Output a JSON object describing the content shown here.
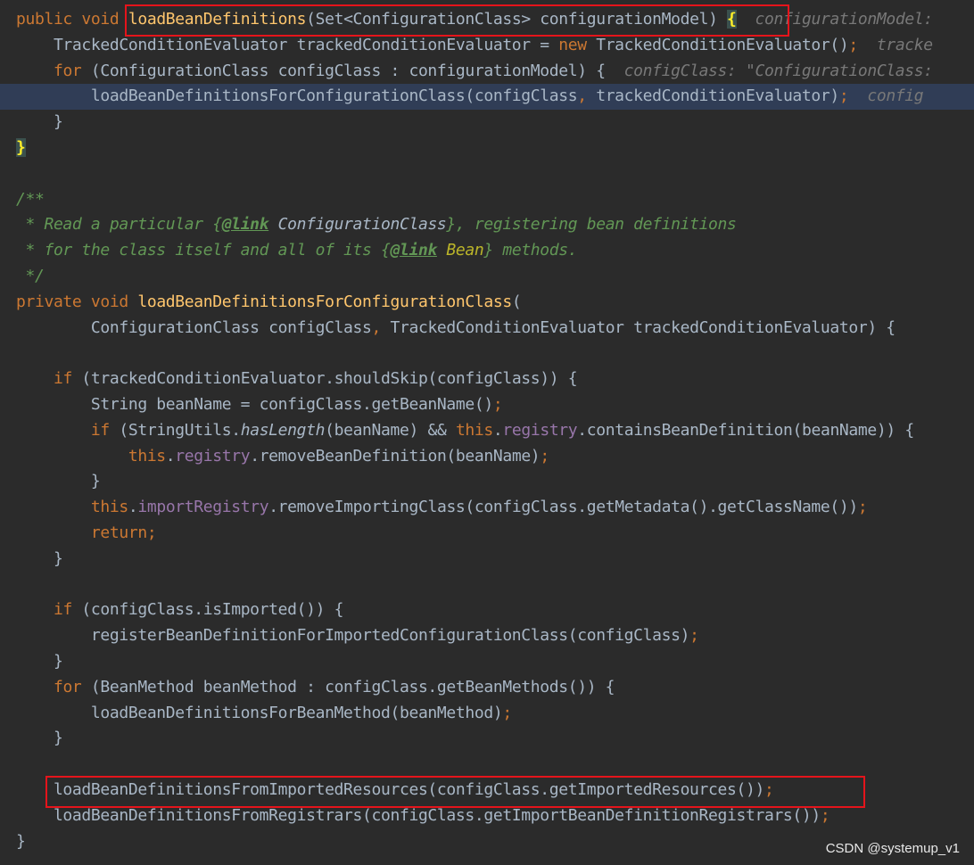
{
  "editor": {
    "lines": [
      [
        [
          "kw",
          "public "
        ],
        [
          "kw",
          "void "
        ],
        [
          "fn",
          "loadBeanDefinitions"
        ],
        [
          "t",
          "(Set<ConfigurationClass> configurationModel) "
        ],
        [
          "brace",
          "{"
        ],
        [
          "t",
          "  "
        ],
        [
          "hint",
          "configurationModel: "
        ]
      ],
      [
        [
          "t",
          "    TrackedConditionEvaluator trackedConditionEvaluator = "
        ],
        [
          "kw",
          "new "
        ],
        [
          "t",
          "TrackedConditionEvaluator()"
        ],
        [
          "kw",
          ";"
        ],
        [
          "t",
          "  "
        ],
        [
          "hint",
          "tracke"
        ]
      ],
      [
        [
          "t",
          "    "
        ],
        [
          "kw",
          "for "
        ],
        [
          "t",
          "(ConfigurationClass configClass : configurationModel) {  "
        ],
        [
          "hint",
          "configClass: \"ConfigurationClass:"
        ]
      ],
      [
        [
          "t",
          "        loadBeanDefinitionsForConfigurationClass(configClass"
        ],
        [
          "kw",
          ", "
        ],
        [
          "t",
          "trackedConditionEvaluator)"
        ],
        [
          "kw",
          ";"
        ],
        [
          "t",
          "  "
        ],
        [
          "hint",
          "config"
        ]
      ],
      [
        [
          "t",
          "    }"
        ]
      ],
      [
        [
          "brace",
          "}"
        ]
      ],
      [],
      [
        [
          "doc",
          "/**"
        ]
      ],
      [
        [
          "doc",
          " * Read a particular {"
        ],
        [
          "doctag",
          "@link"
        ],
        [
          "doc",
          " "
        ],
        [
          "docref",
          "ConfigurationClass"
        ],
        [
          "doc",
          "}, registering bean definitions"
        ]
      ],
      [
        [
          "doc",
          " * for the class itself and all of its {"
        ],
        [
          "doctag",
          "@link"
        ],
        [
          "doc",
          " "
        ],
        [
          "docbean",
          "Bean"
        ],
        [
          "doc",
          "} methods."
        ]
      ],
      [
        [
          "doc",
          " */"
        ]
      ],
      [
        [
          "kw",
          "private "
        ],
        [
          "kw",
          "void "
        ],
        [
          "fn",
          "loadBeanDefinitionsForConfigurationClass"
        ],
        [
          "t",
          "("
        ]
      ],
      [
        [
          "t",
          "        ConfigurationClass configClass"
        ],
        [
          "kw",
          ", "
        ],
        [
          "t",
          "TrackedConditionEvaluator trackedConditionEvaluator) {"
        ]
      ],
      [],
      [
        [
          "t",
          "    "
        ],
        [
          "kw",
          "if "
        ],
        [
          "t",
          "(trackedConditionEvaluator.shouldSkip(configClass)) {"
        ]
      ],
      [
        [
          "t",
          "        String beanName = configClass.getBeanName()"
        ],
        [
          "kw",
          ";"
        ]
      ],
      [
        [
          "t",
          "        "
        ],
        [
          "kw",
          "if "
        ],
        [
          "t",
          "(StringUtils."
        ],
        [
          "it",
          "hasLength"
        ],
        [
          "t",
          "(beanName) && "
        ],
        [
          "kw",
          "this"
        ],
        [
          "t",
          "."
        ],
        [
          "fld",
          "registry"
        ],
        [
          "t",
          ".containsBeanDefinition(beanName)) {"
        ]
      ],
      [
        [
          "t",
          "            "
        ],
        [
          "kw",
          "this"
        ],
        [
          "t",
          "."
        ],
        [
          "fld",
          "registry"
        ],
        [
          "t",
          ".removeBeanDefinition(beanName)"
        ],
        [
          "kw",
          ";"
        ]
      ],
      [
        [
          "t",
          "        }"
        ]
      ],
      [
        [
          "t",
          "        "
        ],
        [
          "kw",
          "this"
        ],
        [
          "t",
          "."
        ],
        [
          "fld",
          "importRegistry"
        ],
        [
          "t",
          ".removeImportingClass(configClass.getMetadata().getClassName())"
        ],
        [
          "kw",
          ";"
        ]
      ],
      [
        [
          "t",
          "        "
        ],
        [
          "kw",
          "return;"
        ]
      ],
      [
        [
          "t",
          "    }"
        ]
      ],
      [],
      [
        [
          "t",
          "    "
        ],
        [
          "kw",
          "if "
        ],
        [
          "t",
          "(configClass.isImported()) {"
        ]
      ],
      [
        [
          "t",
          "        registerBeanDefinitionForImportedConfigurationClass(configClass)"
        ],
        [
          "kw",
          ";"
        ]
      ],
      [
        [
          "t",
          "    }"
        ]
      ],
      [
        [
          "t",
          "    "
        ],
        [
          "kw",
          "for "
        ],
        [
          "t",
          "(BeanMethod beanMethod : configClass.getBeanMethods()) {"
        ]
      ],
      [
        [
          "t",
          "        loadBeanDefinitionsForBeanMethod(beanMethod)"
        ],
        [
          "kw",
          ";"
        ]
      ],
      [
        [
          "t",
          "    }"
        ]
      ],
      [],
      [
        [
          "t",
          "    loadBeanDefinitionsFromImportedResources(configClass.getImportedResources())"
        ],
        [
          "kw",
          ";"
        ]
      ],
      [
        [
          "t",
          "    loadBeanDefinitionsFromRegistrars(configClass.getImportBeanDefinitionRegistrars())"
        ],
        [
          "kw",
          ";"
        ]
      ],
      [
        [
          "t",
          "}"
        ]
      ]
    ]
  },
  "watermark": "CSDN @systemup_v1",
  "colors": {
    "background": "#2b2b2b",
    "current_line": "#303d56",
    "keyword": "#cc7832",
    "method_declaration": "#ffc66d",
    "field": "#9876aa",
    "javadoc": "#629755",
    "inlay_hint": "#787878",
    "annotation_box": "#e5141b"
  }
}
